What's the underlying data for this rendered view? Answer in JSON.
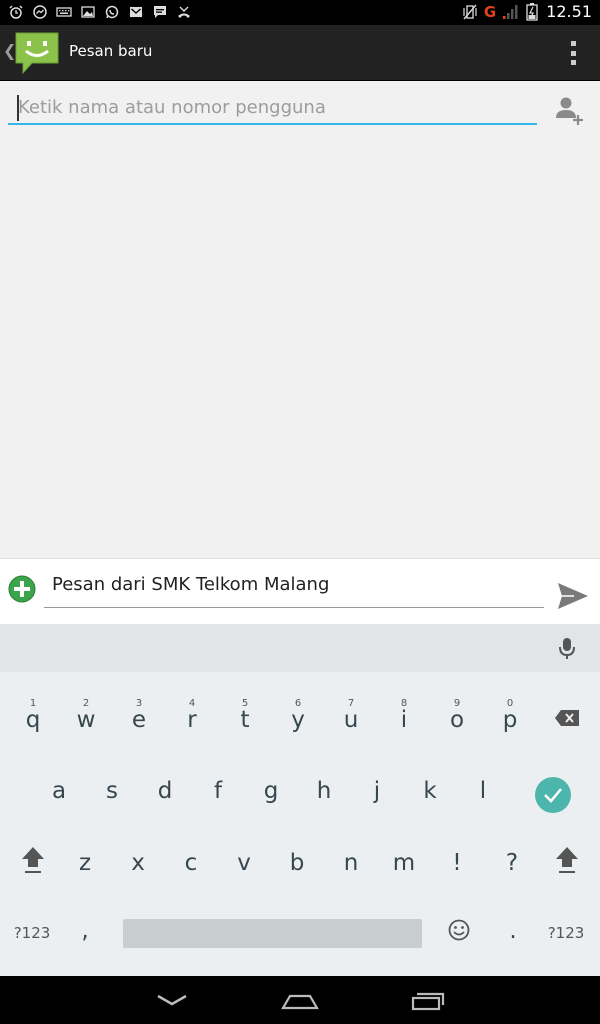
{
  "status_bar": {
    "time": "12.51",
    "network_label": "G",
    "left_icons": [
      "alarm-icon",
      "messenger-icon",
      "keyboard-icon",
      "image-icon",
      "whatsapp-icon",
      "gmail-icon",
      "chat-icon",
      "missed-call-icon"
    ],
    "right_icons": [
      "vibrate-icon",
      "signal-icon",
      "battery-icon"
    ]
  },
  "action_bar": {
    "title": "Pesan baru",
    "app_icon": "messaging-smiley-icon",
    "overflow_icon": "overflow-menu-icon"
  },
  "recipient": {
    "placeholder": "Ketik nama atau nomor pengguna",
    "add_contact_icon": "add-contact-icon"
  },
  "compose": {
    "text": "Pesan dari SMK Telkom Malang",
    "attach_icon": "attach-plus-icon",
    "send_icon": "send-icon"
  },
  "keyboard": {
    "mic_icon": "microphone-icon",
    "row1": [
      {
        "key": "q",
        "hint": "1"
      },
      {
        "key": "w",
        "hint": "2"
      },
      {
        "key": "e",
        "hint": "3"
      },
      {
        "key": "r",
        "hint": "4"
      },
      {
        "key": "t",
        "hint": "5"
      },
      {
        "key": "y",
        "hint": "6"
      },
      {
        "key": "u",
        "hint": "7"
      },
      {
        "key": "i",
        "hint": "8"
      },
      {
        "key": "o",
        "hint": "9"
      },
      {
        "key": "p",
        "hint": "0"
      }
    ],
    "row2": [
      "a",
      "s",
      "d",
      "f",
      "g",
      "h",
      "j",
      "k",
      "l"
    ],
    "row3": [
      "z",
      "x",
      "c",
      "v",
      "b",
      "n",
      "m",
      "!",
      "?"
    ],
    "symbols_label": "?123",
    "comma": ",",
    "period": ".",
    "colors": {
      "accent": "#33b5e5",
      "enter": "#4db6ac",
      "send": "#7a7a7a",
      "attach": "#3aa54b"
    }
  },
  "nav_bar": {
    "back_icon": "nav-back-icon",
    "home_icon": "nav-home-icon",
    "recents_icon": "nav-recents-icon"
  }
}
